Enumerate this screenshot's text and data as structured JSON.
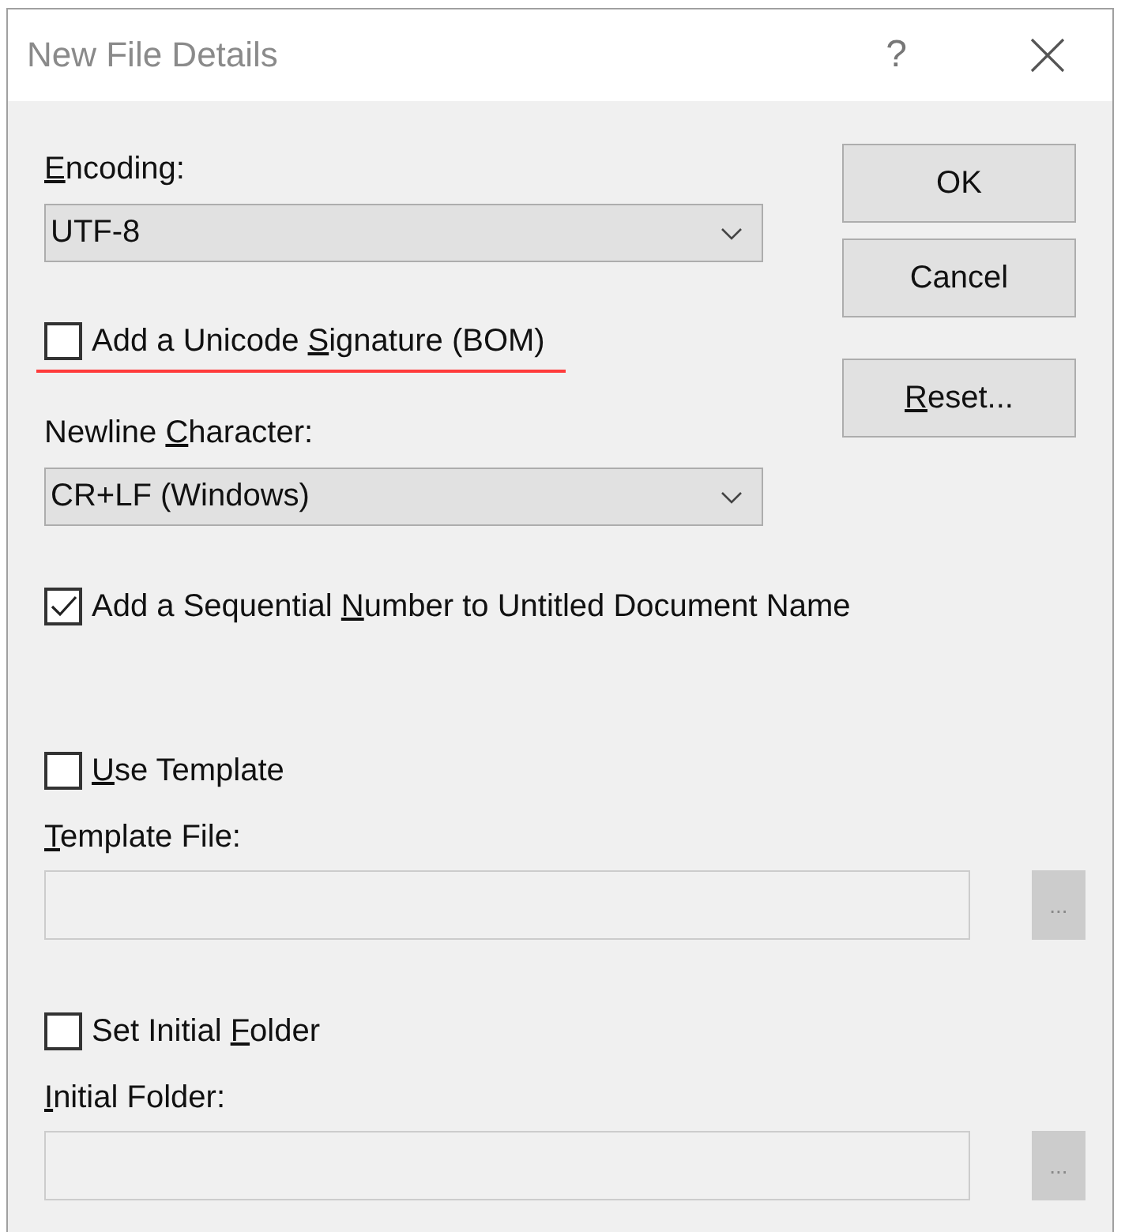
{
  "window": {
    "title": "New File Details",
    "help": "?"
  },
  "top_sections": [
    {
      "items": [
        {
          "kind": "label",
          "text": {
            "key": "E",
            "post": "ncoding:"
          }
        },
        {
          "kind": "combo",
          "value": "UTF-8"
        },
        {
          "kind": "checkbox",
          "text": {
            "pre": "Add a Unicode ",
            "key": "S",
            "post": "ignature (BOM)"
          },
          "checked": false,
          "marked": true
        }
      ]
    },
    {
      "items": [
        {
          "kind": "label",
          "text": {
            "pre": "Newline ",
            "key": "C",
            "post": "haracter:"
          }
        },
        {
          "kind": "combo",
          "value": "CR+LF (Windows)"
        }
      ]
    },
    {
      "items": [
        {
          "kind": "checkbox",
          "text": {
            "pre": "Add a Sequential ",
            "key": "N",
            "post": "umber to Untitled Document Name"
          },
          "checked": true
        }
      ]
    }
  ],
  "buttons": [
    {
      "text": {
        "post": "OK"
      }
    },
    {
      "text": {
        "post": "Cancel"
      }
    },
    {
      "text": {
        "key": "R",
        "post": "eset..."
      }
    }
  ],
  "bottom_sections": [
    {
      "items": [
        {
          "kind": "checkbox",
          "text": {
            "key": "U",
            "post": "se Template"
          },
          "checked": false
        },
        {
          "kind": "label",
          "text": {
            "key": "T",
            "post": "emplate File:"
          }
        },
        {
          "kind": "field",
          "disabled": true,
          "browse": "..."
        }
      ]
    },
    {
      "items": [
        {
          "kind": "checkbox",
          "text": {
            "pre": "Set Initial ",
            "key": "F",
            "post": "older"
          },
          "checked": false
        },
        {
          "kind": "label",
          "text": {
            "key": "I",
            "post": "nitial Folder:"
          }
        },
        {
          "kind": "field",
          "disabled": true,
          "browse": "..."
        }
      ]
    }
  ]
}
